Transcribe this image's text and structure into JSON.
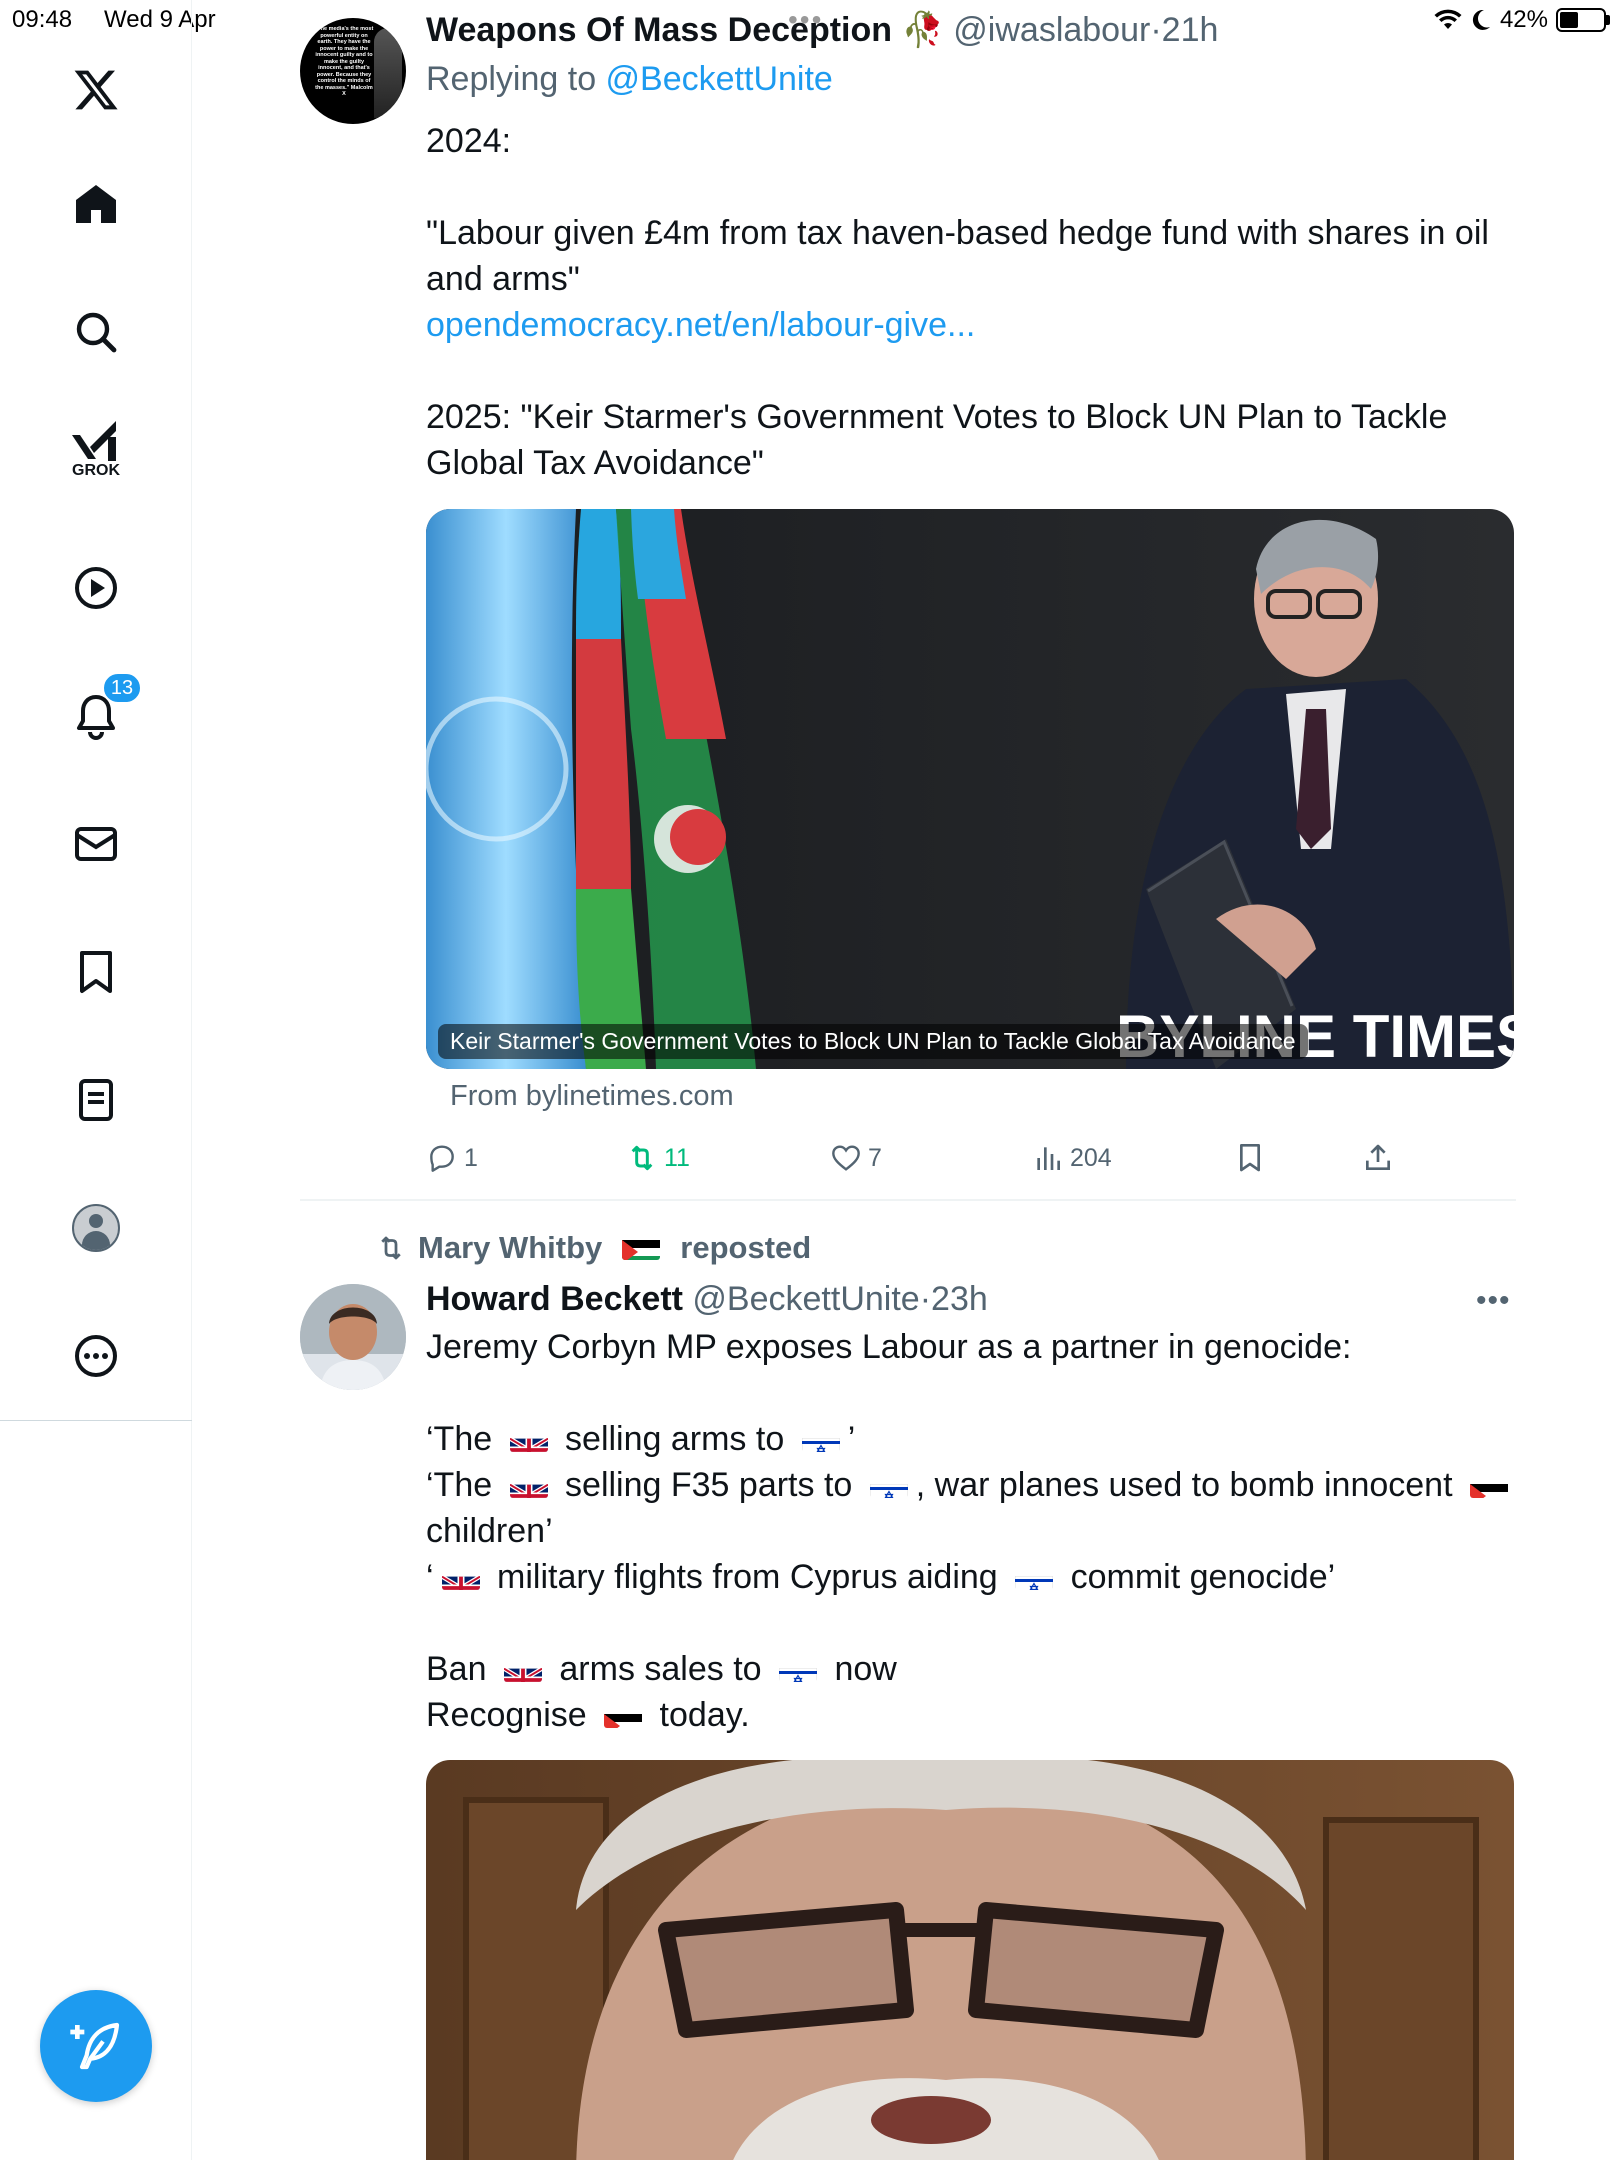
{
  "status_bar": {
    "time": "09:48",
    "date": "Wed 9 Apr",
    "battery": "42%",
    "battery_level": 0.42
  },
  "sidebar": {
    "items": [
      {
        "icon": "x-logo-icon"
      },
      {
        "icon": "home-icon"
      },
      {
        "icon": "search-icon"
      },
      {
        "icon": "grok-icon",
        "label": "GROK"
      },
      {
        "icon": "video-icon"
      },
      {
        "icon": "bell-icon",
        "badge": "13"
      },
      {
        "icon": "mail-icon"
      },
      {
        "icon": "bookmark-icon"
      },
      {
        "icon": "lists-icon"
      },
      {
        "icon": "profile-icon"
      },
      {
        "icon": "more-icon"
      }
    ],
    "compose_icon": "compose-feather-icon"
  },
  "tweet1": {
    "name": "Weapons Of Mass Deception",
    "name_emoji": "🥀",
    "handle": "@iwaslabour",
    "time": "21h",
    "replying_prefix": "Replying to ",
    "replying_to": "@BeckettUnite",
    "text_line1": "2024:",
    "text_quote": "\"Labour given £4m from tax haven-based hedge fund with shares in oil and arms\"",
    "link": "opendemocracy.net/en/labour-give...",
    "text_2025": "2025: \"Keir Starmer's Government Votes to Block UN Plan to Tackle Global Tax Avoidance\"",
    "avatar_text": "\"The media's the most powerful entity on earth. They have the power to make the innocent guilty and to make the guilty innocent, and that's power. Because they control the minds of the masses.\" Malcolm X",
    "card_caption": "Keir Starmer's Government Votes to Block UN Plan to Tackle Global Tax Avoidance",
    "card_watermark": "BYLINE TIMES",
    "card_source": "From bylinetimes.com",
    "replies": "1",
    "reposts": "11",
    "likes": "7",
    "views": "204"
  },
  "tweet2": {
    "reposted_by": "Mary Whitby",
    "reposted_label": "reposted",
    "name": "Howard Beckett",
    "handle": "@BeckettUnite",
    "time": "23h",
    "line1": "Jeremy Corbyn MP exposes Labour as a partner in genocide:",
    "q1_a": "‘The ",
    "q1_b": " selling arms to ",
    "q1_c": "’",
    "q2_a": "‘The ",
    "q2_b": " selling F35 parts to ",
    "q2_c": ", war planes used to bomb innocent ",
    "q2_d": "children’",
    "q3_a": "‘",
    "q3_b": " military flights from Cyprus aiding ",
    "q3_c": " commit genocide’",
    "ban_a": "Ban ",
    "ban_b": " arms sales to ",
    "ban_c": " now",
    "rec_a": "Recognise ",
    "rec_b": " today."
  },
  "colors": {
    "accent": "#1d9bf0",
    "repost_green": "#00ba7c",
    "text_secondary": "#536471"
  }
}
